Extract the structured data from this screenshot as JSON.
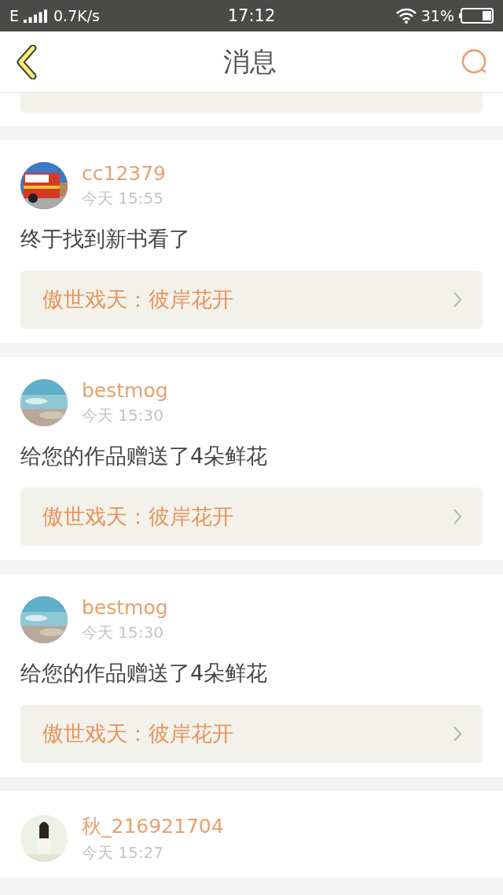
{
  "status_bar": {
    "network": "E",
    "speed": "0.7K/s",
    "time": "17:12",
    "battery": "31%"
  },
  "header": {
    "title": "消息"
  },
  "messages": [
    {
      "user": "cc12379",
      "time": "今天 15:55",
      "text": "终于找到新书看了",
      "book": "傲世戏天：彼岸花开"
    },
    {
      "user": "bestmog",
      "time": "今天 15:30",
      "text": "给您的作品赠送了4朵鲜花",
      "book": "傲世戏天：彼岸花开"
    },
    {
      "user": "bestmog",
      "time": "今天 15:30",
      "text": "给您的作品赠送了4朵鲜花",
      "book": "傲世戏天：彼岸花开"
    },
    {
      "user": "秋_216921704",
      "time": "今天 15:27"
    }
  ]
}
